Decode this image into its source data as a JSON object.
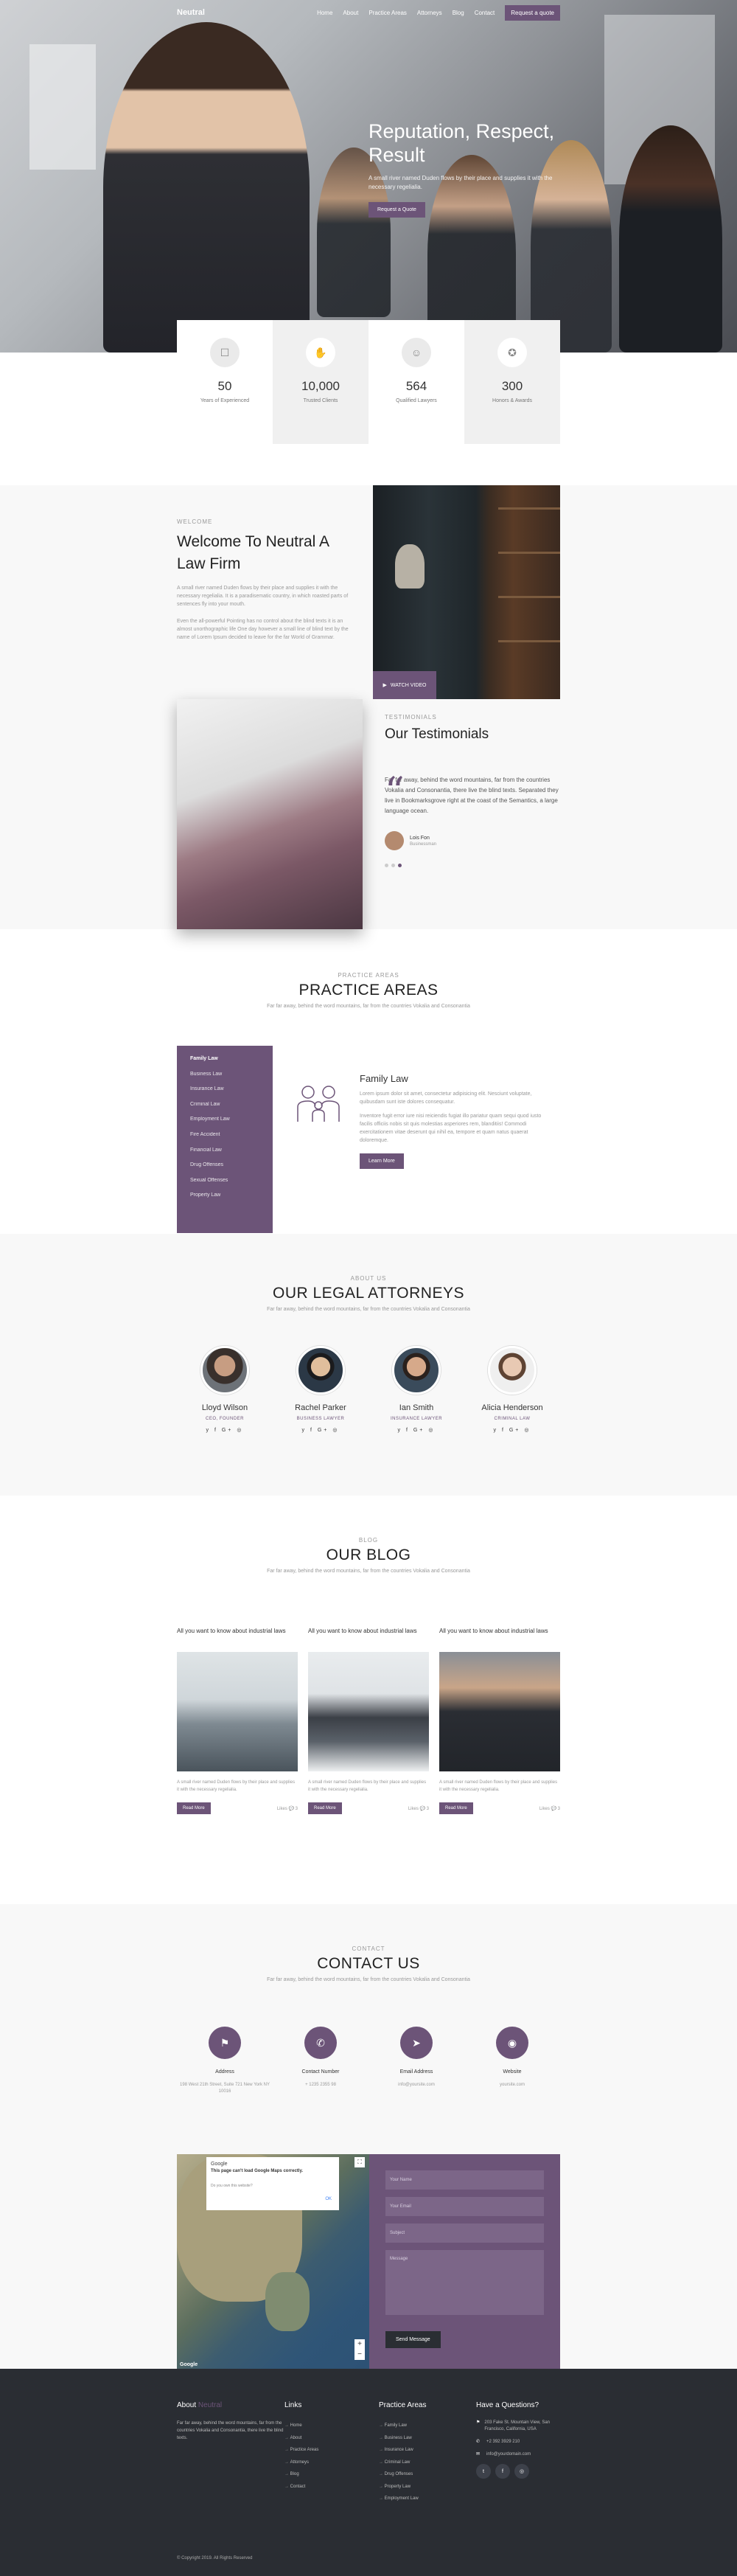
{
  "nav": {
    "logo": "Neutral",
    "links": [
      "Home",
      "About",
      "Practice Areas",
      "Attorneys",
      "Blog",
      "Contact"
    ],
    "cta": "Request a quote"
  },
  "hero": {
    "title": "Reputation, Respect, Result",
    "text": "A small river named Duden flows by their place and supplies it with the necessary regelialia.",
    "button": "Request a Quote"
  },
  "stats": [
    {
      "icon": "handshake-icon",
      "value": "50",
      "label": "Years of Experienced"
    },
    {
      "icon": "clients-icon",
      "value": "10,000",
      "label": "Trusted Clients"
    },
    {
      "icon": "lawyer-icon",
      "value": "564",
      "label": "Qualified Lawyers"
    },
    {
      "icon": "award-icon",
      "value": "300",
      "label": "Honors & Awards"
    }
  ],
  "welcome": {
    "tag": "Welcome",
    "title": "Welcome To Neutral A Law Firm",
    "p1": "A small river named Duden flows by their place and supplies it with the necessary regelialia. It is a paradisematic country, in which roasted parts of sentences fly into your mouth.",
    "p2": "Even the all-powerful Pointing has no control about the blind texts it is an almost unorthographic life One day however a small line of blind text by the name of Lorem Ipsum decided to leave for the far World of Grammar.",
    "video": "WATCH VIDEO"
  },
  "testimonials": {
    "tag": "Testimonials",
    "title": "Our Testimonials",
    "quote": "Far far away, behind the word mountains, far from the countries Vokalia and Consonantia, there live the blind texts. Separated they live in Bookmarksgrove right at the coast of the Semantics, a large language ocean.",
    "name": "Lois Fon",
    "role": "Businessman"
  },
  "practice": {
    "tag": "Practice Areas",
    "title": "PRACTICE AREAS",
    "sub": "Far far away, behind the word mountains, far from the countries Vokalia and Consonantia",
    "items": [
      "Family Law",
      "Business Law",
      "Insurance Law",
      "Criminal Law",
      "Employment Law",
      "Fire Accident",
      "Financial Law",
      "Drug Offenses",
      "Sexual Offenses",
      "Property Law"
    ],
    "detail_title": "Family Law",
    "detail_p1": "Lorem ipsum dolor sit amet, consectetur adipisicing elit. Nesciunt voluptate, quibusdam sunt iste dolores consequatur.",
    "detail_p2": "Inventore fugit error iure nisi reiciendis fugiat illo pariatur quam sequi quod iusto facilis officiis nobis sit quis molestias asperiores rem, blanditiis! Commodi exercitationem vitae deserunt qui nihil ea, tempore et quam natus quaerat doloremque.",
    "button": "Learn More"
  },
  "attorneys": {
    "tag": "About Us",
    "title": "OUR LEGAL ATTORNEYS",
    "sub": "Far far away, behind the word mountains, far from the countries Vokalia and Consonantia",
    "members": [
      {
        "name": "Lloyd Wilson",
        "role": "CEO, Founder"
      },
      {
        "name": "Rachel Parker",
        "role": "Business Lawyer"
      },
      {
        "name": "Ian Smith",
        "role": "Insurance Lawyer"
      },
      {
        "name": "Alicia Henderson",
        "role": "Criminal Law"
      }
    ],
    "social": "y f G+ ◎"
  },
  "blog": {
    "tag": "Blog",
    "title": "OUR BLOG",
    "sub": "Far far away, behind the word mountains, far from the countries Vokalia and Consonantia",
    "posts": [
      {
        "title": "All you want to know about industrial laws",
        "excerpt": "A small river named Duden flows by their place and supplies it with the necessary regelialia.",
        "button": "Read More",
        "meta": "Likes",
        "count": "3"
      },
      {
        "title": "All you want to know about industrial laws",
        "excerpt": "A small river named Duden flows by their place and supplies it with the necessary regelialia.",
        "button": "Read More",
        "meta": "Likes",
        "count": "3"
      },
      {
        "title": "All you want to know about industrial laws",
        "excerpt": "A small river named Duden flows by their place and supplies it with the necessary regelialia.",
        "button": "Read More",
        "meta": "Likes",
        "count": "3"
      }
    ]
  },
  "contact": {
    "tag": "Contact",
    "title": "CONTACT US",
    "sub": "Far far away, behind the word mountains, far from the countries Vokalia and Consonantia",
    "items": [
      {
        "label": "Address",
        "value": "198 West 21th Street, Suite 721 New York NY 10016"
      },
      {
        "label": "Contact Number",
        "value": "+ 1235 2355 98"
      },
      {
        "label": "Email Address",
        "value": "info@yoursite.com"
      },
      {
        "label": "Website",
        "value": "yoursite.com"
      }
    ],
    "map_google": "Google",
    "map_title": "This page can't load Google Maps correctly.",
    "map_sub": "Do you own this website?",
    "map_ok": "OK",
    "map_brand": "Google",
    "form": {
      "name": "Your Name",
      "email": "Your Email",
      "subject": "Subject",
      "message": "Message",
      "send": "Send Message"
    }
  },
  "footer": {
    "about_title_a": "About",
    "about_title_b": "Neutral",
    "about_text": "Far far away, behind the word mountains, far from the countries Vokalia and Consonantia, there live the blind texts.",
    "links_title": "Links",
    "links": [
      "Home",
      "About",
      "Practice Areas",
      "Attorneys",
      "Blog",
      "Contact"
    ],
    "areas_title": "Practice Areas",
    "areas": [
      "Family Law",
      "Business Law",
      "Insurance Law",
      "Criminal Law",
      "Drug Offenses",
      "Property Law",
      "Employment Law"
    ],
    "q_title": "Have a Questions?",
    "address": "203 Fake St. Mountain View, San Francisco, California, USA",
    "phone": "+2 392 3929 210",
    "email": "info@yourdomain.com",
    "copyright": "© Copyright 2019. All Rights Reserved"
  },
  "colors": {
    "accent": "#6c5478",
    "dark": "#2a2d33"
  }
}
